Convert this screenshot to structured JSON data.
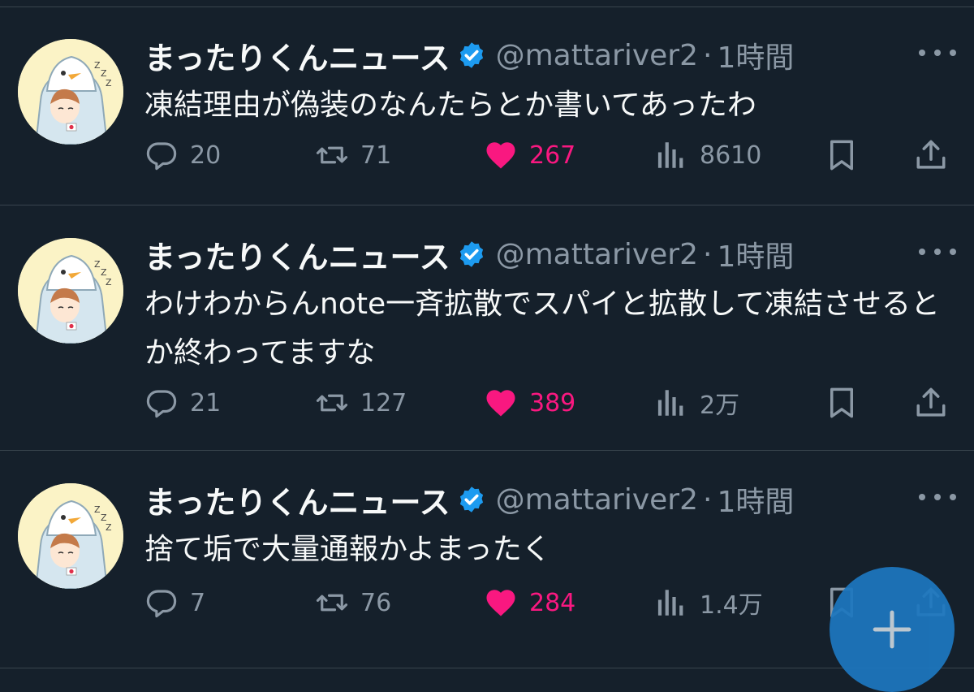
{
  "tweets": [
    {
      "author_name": "まったりくんニュース",
      "handle": "@mattariver2",
      "separator": "·",
      "time": "1時間",
      "text": "凍結理由が偽装のなんたらとか書いてあったわ",
      "replies": "20",
      "retweets": "71",
      "likes": "267",
      "views": "8610"
    },
    {
      "author_name": "まったりくんニュース",
      "handle": "@mattariver2",
      "separator": "·",
      "time": "1時間",
      "text": "わけわからんnote一斉拡散でスパイと拡散して凍結させるとか終わってますな",
      "replies": "21",
      "retweets": "127",
      "likes": "389",
      "views": "2万"
    },
    {
      "author_name": "まったりくんニュース",
      "handle": "@mattariver2",
      "separator": "·",
      "time": "1時間",
      "text": "捨て垢で大量通報かよまったく",
      "replies": "7",
      "retweets": "76",
      "likes": "284",
      "views": "1.4万"
    }
  ],
  "icons": {
    "reply": "reply-icon",
    "retweet": "retweet-icon",
    "like": "heart-icon",
    "views": "views-icon",
    "bookmark": "bookmark-icon",
    "share": "share-icon",
    "verified": "verified-badge-icon",
    "more": "more-icon",
    "compose": "plus-icon"
  },
  "colors": {
    "background": "#15202b",
    "text_primary": "#f7f9f9",
    "text_secondary": "#8b98a5",
    "like_active": "#f91880",
    "verified": "#1d9bf0",
    "fab": "#1d77bf"
  }
}
